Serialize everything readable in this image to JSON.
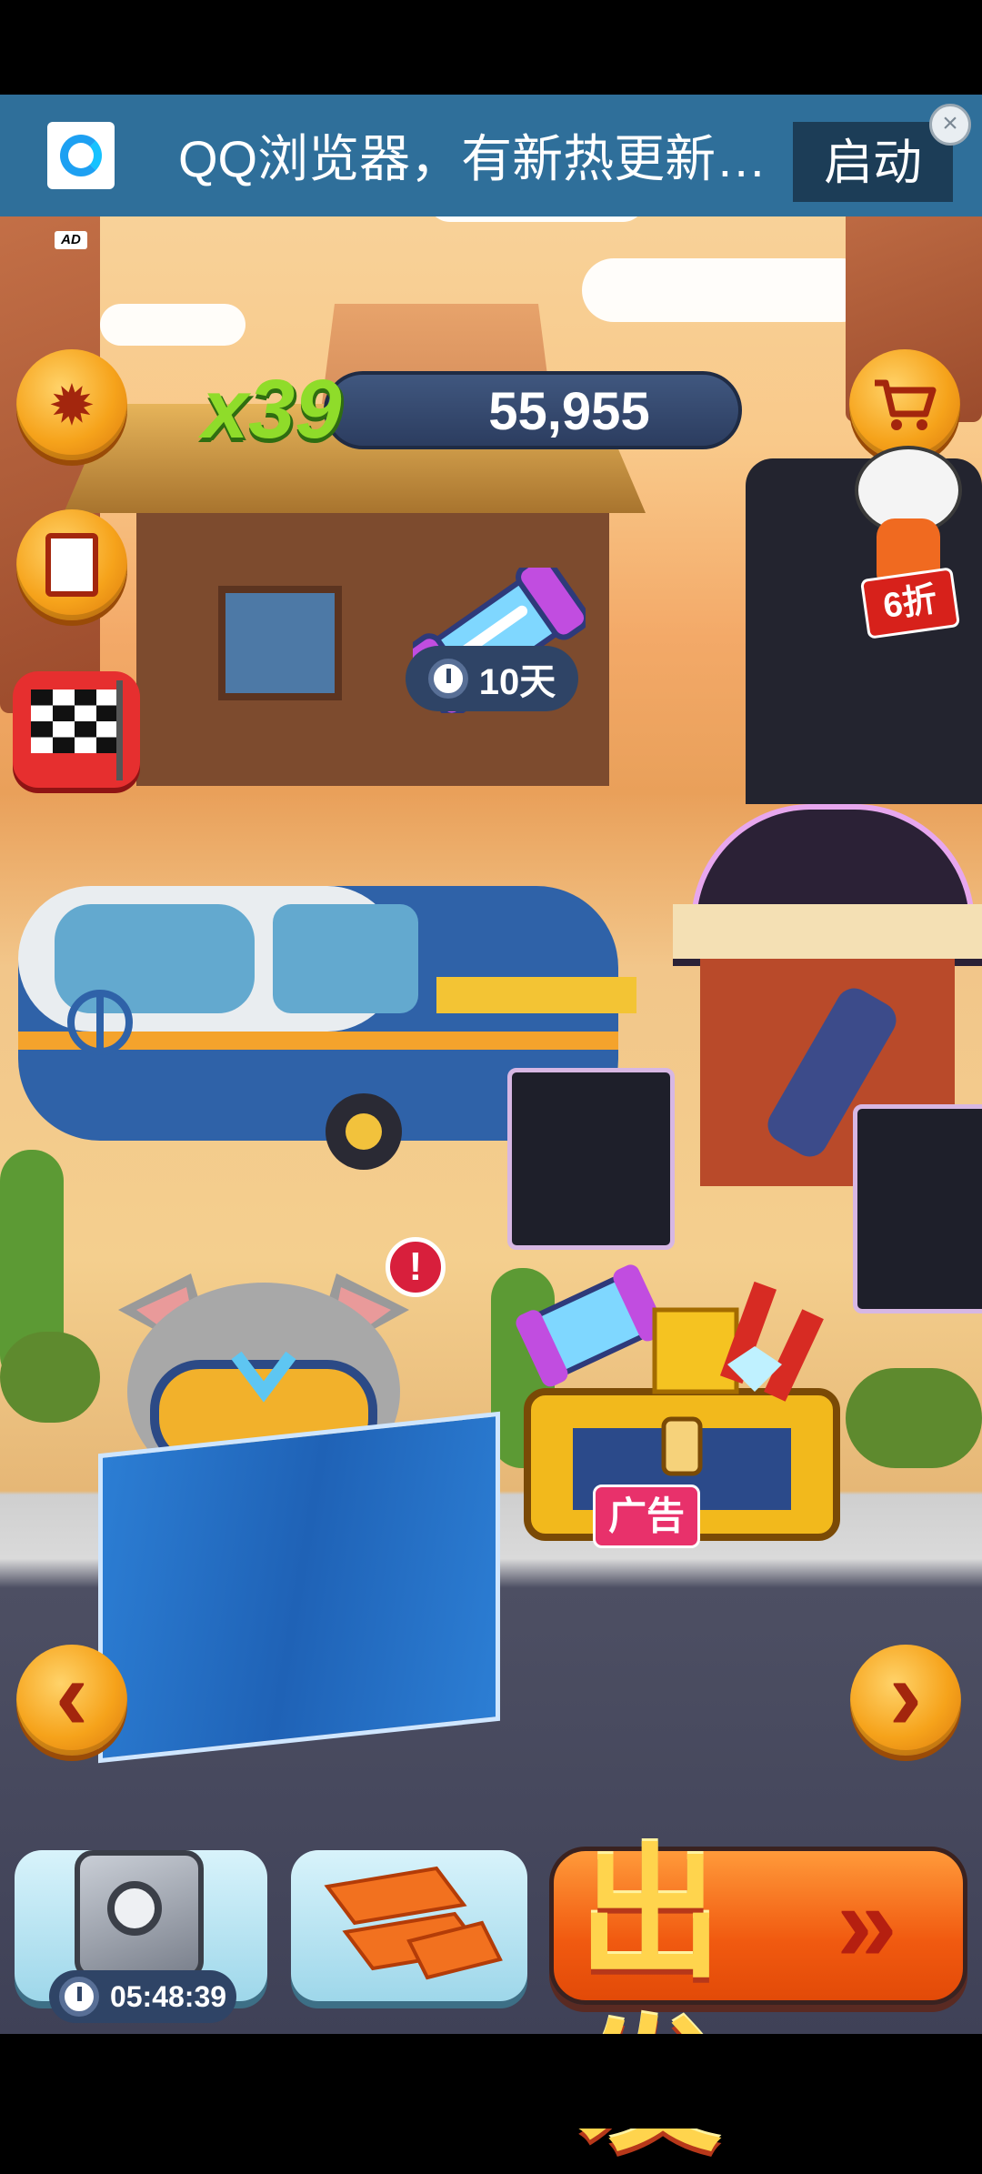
{
  "ad": {
    "app_name": "QQ浏览器，有新热更新…",
    "cta": "启动",
    "close": "×",
    "tag": "AD"
  },
  "hud": {
    "multiplier": "x39",
    "coins": "55,955",
    "booster_timer": "10天"
  },
  "shop": {
    "discount_badge": "6折"
  },
  "character": {
    "alert": "!"
  },
  "chest": {
    "label": "广告"
  },
  "bottom": {
    "safe_timer": "05:48:39",
    "go_label": "出发",
    "go_arrows": "»",
    "prev": "‹",
    "next": "›"
  },
  "colors": {
    "orange_button": "#f6a31b",
    "coin_bar": "#2c3d60",
    "multiplier_green": "#8fdc2a",
    "go_button": "#f15a10",
    "ad_banner": "#2f6f9a"
  }
}
